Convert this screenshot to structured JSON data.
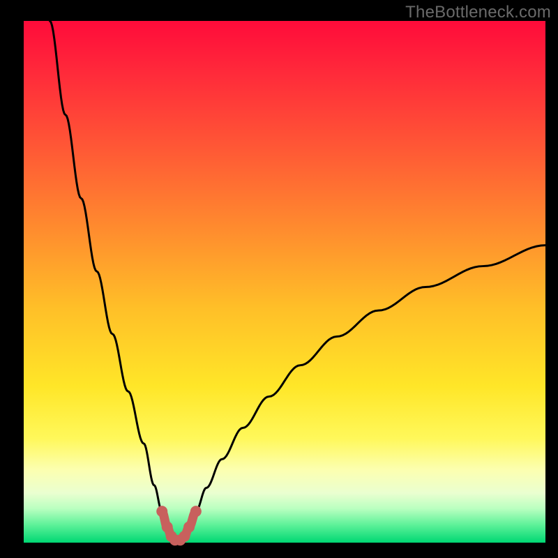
{
  "watermark": "TheBottleneck.com",
  "colors": {
    "background": "#000000",
    "gradient_stops": [
      {
        "offset": 0.0,
        "color": "#ff0b3a"
      },
      {
        "offset": 0.1,
        "color": "#ff2a3a"
      },
      {
        "offset": 0.25,
        "color": "#ff5a35"
      },
      {
        "offset": 0.4,
        "color": "#ff8c2e"
      },
      {
        "offset": 0.55,
        "color": "#ffbf28"
      },
      {
        "offset": 0.7,
        "color": "#ffe628"
      },
      {
        "offset": 0.8,
        "color": "#fff85a"
      },
      {
        "offset": 0.86,
        "color": "#fcffb0"
      },
      {
        "offset": 0.905,
        "color": "#eaffd0"
      },
      {
        "offset": 0.935,
        "color": "#b9ffc0"
      },
      {
        "offset": 0.965,
        "color": "#60f29a"
      },
      {
        "offset": 1.0,
        "color": "#00d873"
      }
    ],
    "curve": "#000000",
    "marker_fill": "#c8605d",
    "marker_stroke": "#c8605d"
  },
  "chart_data": {
    "type": "line",
    "title": "",
    "xlabel": "",
    "ylabel": "",
    "xlim": [
      0,
      100
    ],
    "ylim": [
      0,
      100
    ],
    "note": "Bottleneck-percentage style curve: V-shaped, minimum near x≈29 at y≈0; left branch rises to y=100 at x≈5; right branch rises to y≈57 at x=100. Background gradient encodes severity (red=high, green=low).",
    "series": [
      {
        "name": "bottleneck-curve",
        "x": [
          5,
          8,
          11,
          14,
          17,
          20,
          23,
          25,
          26.5,
          27.5,
          28.3,
          29,
          30,
          30.8,
          31.7,
          33,
          35,
          38,
          42,
          47,
          53,
          60,
          68,
          77,
          88,
          100
        ],
        "y": [
          100,
          82,
          66,
          52,
          40,
          29,
          19,
          11,
          6,
          3,
          1.2,
          0.5,
          0.5,
          1.2,
          3,
          6,
          10.5,
          16,
          22,
          28,
          34,
          39.5,
          44.5,
          49,
          53,
          57
        ]
      }
    ],
    "markers": {
      "name": "highlighted-dip",
      "x": [
        26.5,
        27.5,
        28.3,
        29,
        30,
        30.8,
        31.7,
        33
      ],
      "y": [
        6,
        3,
        1.2,
        0.5,
        0.5,
        1.2,
        3,
        6
      ]
    }
  }
}
